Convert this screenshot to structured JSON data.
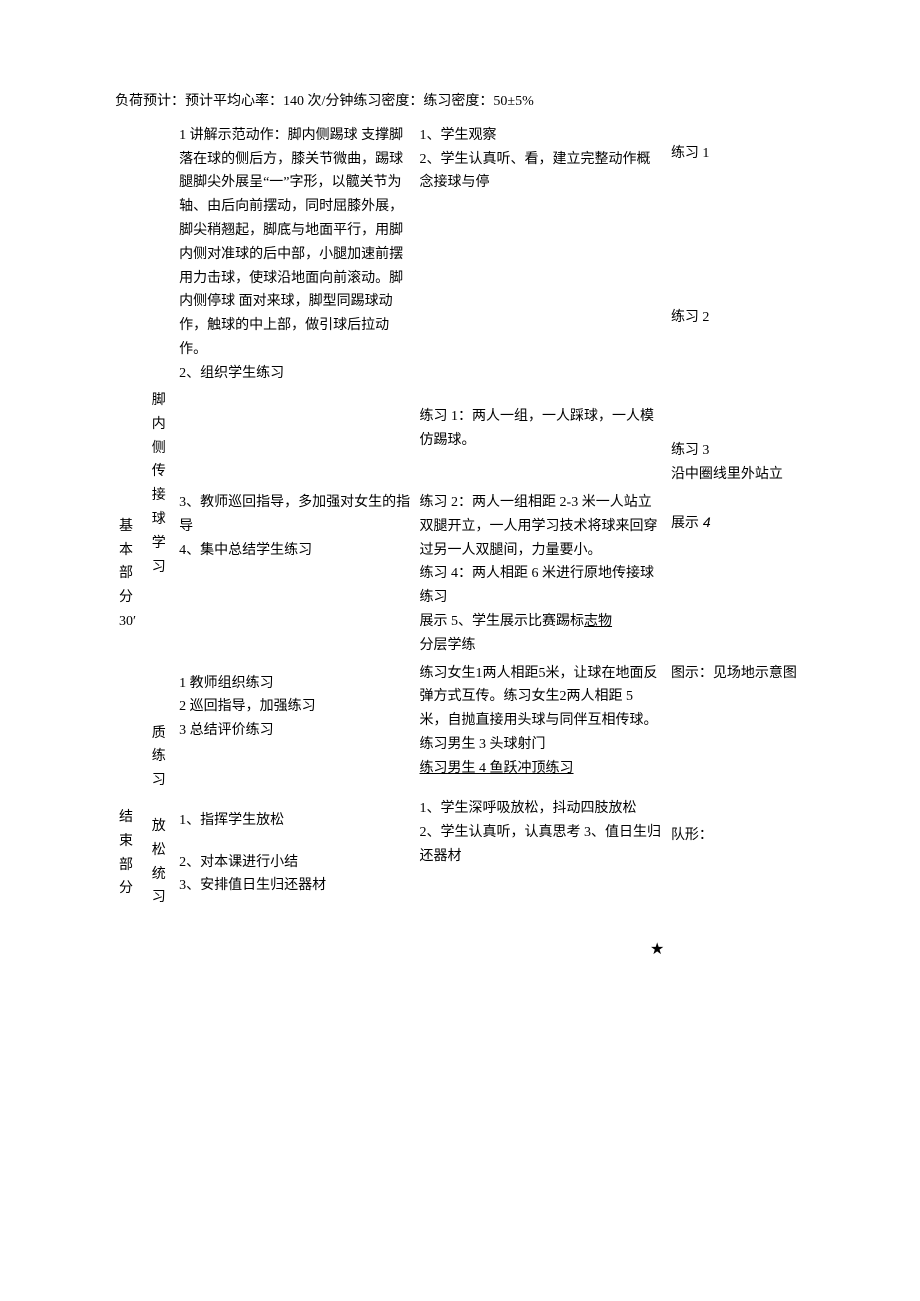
{
  "header": "负荷预计：预计平均心率：140 次/分钟练习密度：练习密度：50±5%",
  "section1": {
    "label_line1": "基",
    "label_line2": "本",
    "label_line3": "部",
    "label_line4": "分",
    "label_time": "30′",
    "activity1": {
      "l1": "脚",
      "l2": "内",
      "l3": "侧",
      "l4": "传",
      "l5": "接",
      "l6": "球",
      "l7": "学",
      "l8": "习"
    },
    "activity2": {
      "l1": "质",
      "l2": "练",
      "l3": "习"
    },
    "teacher1": {
      "p1": "1 讲解示范动作：脚内侧踢球 支撑脚落在球的侧后方，膝关节微曲，踢球腿脚尖外展呈“一”字形，以髋关节为轴、由后向前摆动，同时屈膝外展，脚尖稍翘起，脚底与地面平行，用脚内侧对准球的后中部，小腿加速前摆用力击球，使球沿地面向前滚动。脚内侧停球 面对来球，脚型同踢球动作，触球的中上部，做引球后拉动作。",
      "p2": "2、组织学生练习",
      "p3": "3、教师巡回指导，多加强对女生的指导",
      "p4": "4、集中总结学生练习"
    },
    "student1": {
      "p1": "1、学生观察",
      "p2": "2、学生认真听、看，建立完整动作概念接球与停",
      "p3": "练习 1：两人一组，一人踩球，一人模仿踢球。",
      "p4": "练习 2：两人一组相距 2-3 米一人站立双腿开立，一人用学习技术将球来回穿过另一人双腿间，力量要小。",
      "p5": "练习 4：两人相距 6 米进行原地传接球练习",
      "p6_a": "展示 5、学生展示比赛踢标",
      "p6_b": "志物",
      "p7": "分层学练",
      "p8": "练习女生1两人相距5米，让球在地面反弹方式互传。练习女生2两人相距 5 米，自抛直接用头球与同伴互相传球。",
      "p9": "练习男生 3 头球射门",
      "p10": "练习男生 4 鱼跃冲顶练习"
    },
    "teacher2": {
      "p1": "1 教师组织练习",
      "p2": "2 巡回指导，加强练习",
      "p3": "3 总结评价练习"
    },
    "diagram1": {
      "d1": "练习 1",
      "d2": "练习 2",
      "d3": "练习 3",
      "d3b": "沿中圈线里外站立",
      "d4a": "展示",
      "d4b": " 4",
      "d5": "图示：见场地示意图"
    }
  },
  "section2": {
    "label_line1": "结",
    "label_line2": "束",
    "label_line3": "部",
    "label_line4": "分",
    "activity": {
      "l1": "放",
      "l2": "松",
      "l3": "统",
      "l4": "习"
    },
    "teacher": {
      "p1": "1、指挥学生放松",
      "p2": "2、对本课进行小结",
      "p3": "3、安排值日生归还器材"
    },
    "student": {
      "p1": "1、学生深呼吸放松，抖动四肢放松",
      "p2": "2、学生认真听，认真思考 3、值日生归还器材"
    },
    "diagram": {
      "d1": "队形："
    }
  },
  "star": "★"
}
